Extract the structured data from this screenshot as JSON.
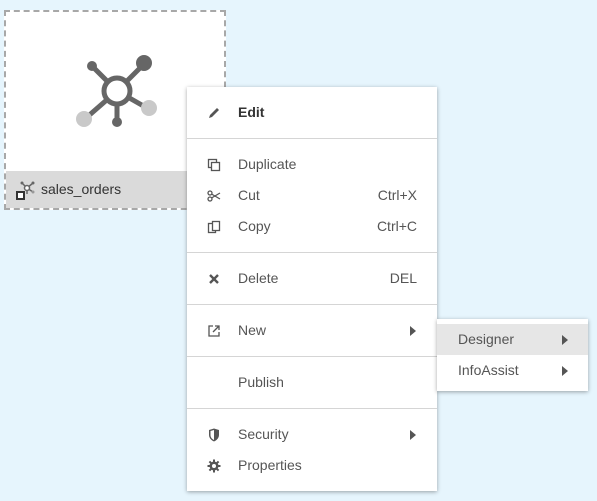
{
  "tile": {
    "name": "sales_orders"
  },
  "menu": {
    "items": [
      {
        "label": "Edit",
        "icon": "pencil-icon"
      },
      {
        "label": "Duplicate",
        "icon": "duplicate-icon"
      },
      {
        "label": "Cut",
        "shortcut": "Ctrl+X",
        "icon": "scissors-icon"
      },
      {
        "label": "Copy",
        "shortcut": "Ctrl+C",
        "icon": "copy-icon"
      },
      {
        "label": "Delete",
        "shortcut": "DEL",
        "icon": "x-icon"
      },
      {
        "label": "New",
        "icon": "new-external-icon",
        "has_submenu": true
      },
      {
        "label": "Publish"
      },
      {
        "label": "Security",
        "icon": "shield-icon",
        "has_submenu": true
      },
      {
        "label": "Properties",
        "icon": "gear-icon"
      }
    ]
  },
  "submenu": {
    "items": [
      {
        "label": "Designer",
        "highlighted": true,
        "has_submenu": true
      },
      {
        "label": "InfoAssist",
        "has_submenu": true
      }
    ]
  },
  "colors": {
    "background": "#e6f5fd",
    "menu_text": "#555555",
    "highlight": "#e6e6e6"
  }
}
